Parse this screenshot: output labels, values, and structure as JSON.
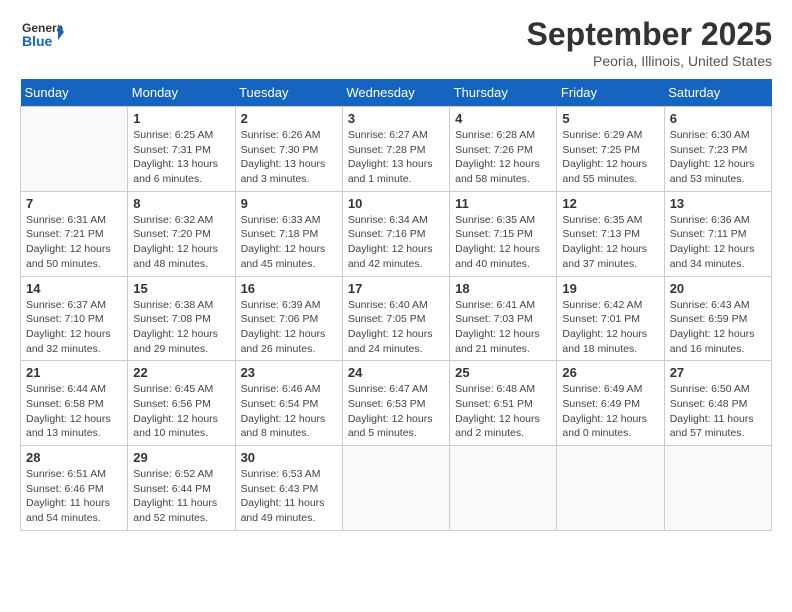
{
  "logo": {
    "general": "General",
    "blue": "Blue"
  },
  "title": "September 2025",
  "subtitle": "Peoria, Illinois, United States",
  "weekdays": [
    "Sunday",
    "Monday",
    "Tuesday",
    "Wednesday",
    "Thursday",
    "Friday",
    "Saturday"
  ],
  "weeks": [
    [
      {
        "day": "",
        "info": ""
      },
      {
        "day": "1",
        "info": "Sunrise: 6:25 AM\nSunset: 7:31 PM\nDaylight: 13 hours\nand 6 minutes."
      },
      {
        "day": "2",
        "info": "Sunrise: 6:26 AM\nSunset: 7:30 PM\nDaylight: 13 hours\nand 3 minutes."
      },
      {
        "day": "3",
        "info": "Sunrise: 6:27 AM\nSunset: 7:28 PM\nDaylight: 13 hours\nand 1 minute."
      },
      {
        "day": "4",
        "info": "Sunrise: 6:28 AM\nSunset: 7:26 PM\nDaylight: 12 hours\nand 58 minutes."
      },
      {
        "day": "5",
        "info": "Sunrise: 6:29 AM\nSunset: 7:25 PM\nDaylight: 12 hours\nand 55 minutes."
      },
      {
        "day": "6",
        "info": "Sunrise: 6:30 AM\nSunset: 7:23 PM\nDaylight: 12 hours\nand 53 minutes."
      }
    ],
    [
      {
        "day": "7",
        "info": "Sunrise: 6:31 AM\nSunset: 7:21 PM\nDaylight: 12 hours\nand 50 minutes."
      },
      {
        "day": "8",
        "info": "Sunrise: 6:32 AM\nSunset: 7:20 PM\nDaylight: 12 hours\nand 48 minutes."
      },
      {
        "day": "9",
        "info": "Sunrise: 6:33 AM\nSunset: 7:18 PM\nDaylight: 12 hours\nand 45 minutes."
      },
      {
        "day": "10",
        "info": "Sunrise: 6:34 AM\nSunset: 7:16 PM\nDaylight: 12 hours\nand 42 minutes."
      },
      {
        "day": "11",
        "info": "Sunrise: 6:35 AM\nSunset: 7:15 PM\nDaylight: 12 hours\nand 40 minutes."
      },
      {
        "day": "12",
        "info": "Sunrise: 6:35 AM\nSunset: 7:13 PM\nDaylight: 12 hours\nand 37 minutes."
      },
      {
        "day": "13",
        "info": "Sunrise: 6:36 AM\nSunset: 7:11 PM\nDaylight: 12 hours\nand 34 minutes."
      }
    ],
    [
      {
        "day": "14",
        "info": "Sunrise: 6:37 AM\nSunset: 7:10 PM\nDaylight: 12 hours\nand 32 minutes."
      },
      {
        "day": "15",
        "info": "Sunrise: 6:38 AM\nSunset: 7:08 PM\nDaylight: 12 hours\nand 29 minutes."
      },
      {
        "day": "16",
        "info": "Sunrise: 6:39 AM\nSunset: 7:06 PM\nDaylight: 12 hours\nand 26 minutes."
      },
      {
        "day": "17",
        "info": "Sunrise: 6:40 AM\nSunset: 7:05 PM\nDaylight: 12 hours\nand 24 minutes."
      },
      {
        "day": "18",
        "info": "Sunrise: 6:41 AM\nSunset: 7:03 PM\nDaylight: 12 hours\nand 21 minutes."
      },
      {
        "day": "19",
        "info": "Sunrise: 6:42 AM\nSunset: 7:01 PM\nDaylight: 12 hours\nand 18 minutes."
      },
      {
        "day": "20",
        "info": "Sunrise: 6:43 AM\nSunset: 6:59 PM\nDaylight: 12 hours\nand 16 minutes."
      }
    ],
    [
      {
        "day": "21",
        "info": "Sunrise: 6:44 AM\nSunset: 6:58 PM\nDaylight: 12 hours\nand 13 minutes."
      },
      {
        "day": "22",
        "info": "Sunrise: 6:45 AM\nSunset: 6:56 PM\nDaylight: 12 hours\nand 10 minutes."
      },
      {
        "day": "23",
        "info": "Sunrise: 6:46 AM\nSunset: 6:54 PM\nDaylight: 12 hours\nand 8 minutes."
      },
      {
        "day": "24",
        "info": "Sunrise: 6:47 AM\nSunset: 6:53 PM\nDaylight: 12 hours\nand 5 minutes."
      },
      {
        "day": "25",
        "info": "Sunrise: 6:48 AM\nSunset: 6:51 PM\nDaylight: 12 hours\nand 2 minutes."
      },
      {
        "day": "26",
        "info": "Sunrise: 6:49 AM\nSunset: 6:49 PM\nDaylight: 12 hours\nand 0 minutes."
      },
      {
        "day": "27",
        "info": "Sunrise: 6:50 AM\nSunset: 6:48 PM\nDaylight: 11 hours\nand 57 minutes."
      }
    ],
    [
      {
        "day": "28",
        "info": "Sunrise: 6:51 AM\nSunset: 6:46 PM\nDaylight: 11 hours\nand 54 minutes."
      },
      {
        "day": "29",
        "info": "Sunrise: 6:52 AM\nSunset: 6:44 PM\nDaylight: 11 hours\nand 52 minutes."
      },
      {
        "day": "30",
        "info": "Sunrise: 6:53 AM\nSunset: 6:43 PM\nDaylight: 11 hours\nand 49 minutes."
      },
      {
        "day": "",
        "info": ""
      },
      {
        "day": "",
        "info": ""
      },
      {
        "day": "",
        "info": ""
      },
      {
        "day": "",
        "info": ""
      }
    ]
  ]
}
